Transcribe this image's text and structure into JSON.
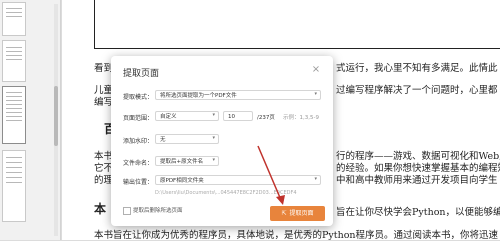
{
  "thumbnails": {
    "selected_page_number": ""
  },
  "document": {
    "lines": [
      {
        "text": "看到",
        "pos": "a"
      },
      {
        "text": "式运行，我心里不知有多满足。此情此",
        "pos": "b"
      },
      {
        "text": "儿童",
        "pos": "c"
      },
      {
        "text": "过编写程序解决了一个问题时，心里都",
        "pos": "d"
      },
      {
        "text": "编写",
        "pos": "e"
      },
      {
        "text": "本书",
        "pos": "g"
      },
      {
        "text": "行的程序——游戏、数据可视化和Web应",
        "pos": "h"
      },
      {
        "text": "它不",
        "pos": "i"
      },
      {
        "text": "的经验。如果你想快速掌握基本的编程知",
        "pos": "j"
      },
      {
        "text": "的理",
        "pos": "k"
      },
      {
        "text": "中和高中教师用来通过开发项目向学生",
        "pos": "l"
      },
      {
        "text": "旨在让你尽快学会Python，以便能够编写",
        "pos": "n"
      },
      {
        "text": "本书旨在让你成为优秀的程序员，具体地说，是优秀的Python程序员。通过阅读本书，你将迅速",
        "pos": "o"
      }
    ],
    "heading_1": "百",
    "heading_2": "本"
  },
  "dialog": {
    "title": "提取页面",
    "close_glyph": "×",
    "mode_label": "提取模式：",
    "mode_value": "将所选页面提取为一个PDF文件",
    "range_label": "页面范围：",
    "range_value": "自定义",
    "range_start": "10",
    "range_total": "/237页",
    "range_hint": "示例：1,3,5-9",
    "watermark_label": "添加水印：",
    "watermark_value": "无",
    "filename_label": "文件命名：",
    "filename_value": "提取后+原文件名",
    "output_label": "输出位置：",
    "output_value": "原PDF相同文件夹",
    "output_path": "D:\\Users\\liu\\Documents\\...045447E8C2F2D03...E9CEDF4",
    "delete_label": "提取后删除所选页面",
    "extract_button": "提取页面",
    "extract_icon": "extract-icon"
  },
  "colors": {
    "accent": "#e8843c",
    "annotation_arrow": "#c0322c"
  }
}
